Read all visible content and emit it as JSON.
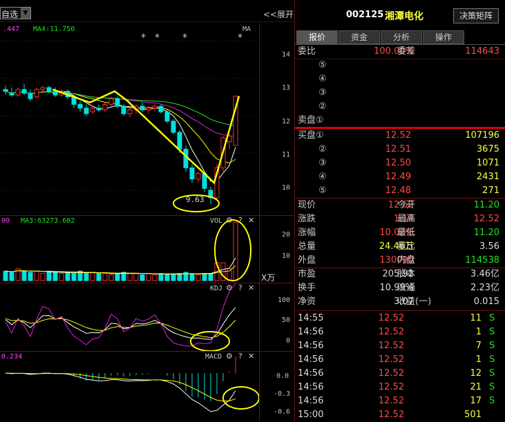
{
  "toolbar": {
    "watchlist_select": "自选",
    "expand_label": "<<展开"
  },
  "kline": {
    "ma_left": ".447",
    "ma4": "MA4:11.750",
    "ma_tag": "MA",
    "stars": [
      "*",
      "*",
      "*",
      "*"
    ],
    "price_axis": [
      "14",
      "13",
      "12",
      "11",
      "10"
    ],
    "low_label": "9.63"
  },
  "vol": {
    "left_value": "00",
    "ma3": "MA3:63273.602",
    "title": "VOL",
    "axis": [
      "20",
      "10"
    ],
    "unit": "X万"
  },
  "kdj": {
    "title": "KDJ",
    "axis": [
      "100",
      "50",
      "0"
    ]
  },
  "macd": {
    "left_value": "0.234",
    "title": "MACD",
    "axis": [
      "0.0",
      "-0.3",
      "-0.6"
    ]
  },
  "panel_icons": {
    "gear": "⚙",
    "help": "?",
    "close": "✕"
  },
  "stock": {
    "code": "002125",
    "name": "湘潭电化",
    "decision_button": "决策矩阵"
  },
  "tabs": [
    "报价",
    "资金",
    "分析",
    "操作"
  ],
  "order_summary": {
    "weibi_label": "委比",
    "weibi_value": "100.00%",
    "weicha_label": "委差",
    "weicha_value": "114643"
  },
  "sell_orders": [
    {
      "label": "⑤",
      "price": "",
      "vol": ""
    },
    {
      "label": "④",
      "price": "",
      "vol": ""
    },
    {
      "label": "③",
      "price": "",
      "vol": ""
    },
    {
      "label": "②",
      "price": "",
      "vol": ""
    },
    {
      "label": "卖盘①",
      "price": "",
      "vol": ""
    }
  ],
  "buy_orders": [
    {
      "label": "买盘①",
      "price": "12.52",
      "vol": "107196"
    },
    {
      "label": "②",
      "price": "12.51",
      "vol": "3675"
    },
    {
      "label": "③",
      "price": "12.50",
      "vol": "1071"
    },
    {
      "label": "④",
      "price": "12.49",
      "vol": "2431"
    },
    {
      "label": "⑤",
      "price": "12.48",
      "vol": "271"
    }
  ],
  "quote": [
    {
      "l1": "现价",
      "v1": "12.52",
      "c1": "red",
      "l2": "今开",
      "v2": "11.20",
      "c2": "grn"
    },
    {
      "l1": "涨跌",
      "v1": "1.14",
      "c1": "red",
      "l2": "最高",
      "v2": "12.52",
      "c2": "red"
    },
    {
      "l1": "涨幅",
      "v1": "10.02%",
      "c1": "red",
      "l2": "最低",
      "v2": "11.20",
      "c2": "grn"
    },
    {
      "l1": "总量",
      "v1": "24.46万",
      "c1": "yel",
      "l2": "量比",
      "v2": "3.56",
      "c2": "wht"
    },
    {
      "l1": "外盘",
      "v1": "130090",
      "c1": "red",
      "l2": "内盘",
      "v2": "114538",
      "c2": "grn"
    }
  ],
  "fundamentals": [
    {
      "l1": "市盈",
      "v1": "205.92",
      "l2": "股本",
      "v2": "3.46亿"
    },
    {
      "l1": "换手",
      "v1": "10.99%",
      "l2": "流通",
      "v2": "2.23亿"
    },
    {
      "l1": "净资",
      "v1": "3.07",
      "l2": "收益(一)",
      "v2": "0.015"
    }
  ],
  "ticks": [
    {
      "time": "14:55",
      "price": "12.52",
      "vol": "11",
      "side": "S"
    },
    {
      "time": "14:56",
      "price": "12.52",
      "vol": "1",
      "side": "S"
    },
    {
      "time": "14:56",
      "price": "12.52",
      "vol": "7",
      "side": "S"
    },
    {
      "time": "14:56",
      "price": "12.52",
      "vol": "1",
      "side": "S"
    },
    {
      "time": "14:56",
      "price": "12.52",
      "vol": "12",
      "side": "S"
    },
    {
      "time": "14:56",
      "price": "12.52",
      "vol": "21",
      "side": "S"
    },
    {
      "time": "14:56",
      "price": "12.52",
      "vol": "17",
      "side": "S"
    },
    {
      "time": "15:00",
      "price": "12.52",
      "vol": "501",
      "side": ""
    }
  ],
  "colors": {
    "up": "#ff3030",
    "down": "#00e0e0",
    "ma_white": "#ffffff",
    "ma_yellow": "#ffff00",
    "ma_purple": "#e020e0",
    "ma_green": "#20e020",
    "annotation": "#ffff00"
  },
  "chart_data": [
    {
      "type": "candlestick",
      "ohlc": [
        [
          12.7,
          12.8,
          12.55,
          12.65
        ],
        [
          12.6,
          12.75,
          12.5,
          12.55
        ],
        [
          12.55,
          12.75,
          12.5,
          12.7
        ],
        [
          12.7,
          12.85,
          12.55,
          12.6
        ],
        [
          12.6,
          12.7,
          12.4,
          12.45
        ],
        [
          12.5,
          12.75,
          12.45,
          12.7
        ],
        [
          12.7,
          12.8,
          12.6,
          12.75
        ],
        [
          12.75,
          12.8,
          12.6,
          12.65
        ],
        [
          12.65,
          12.75,
          12.5,
          12.55
        ],
        [
          12.55,
          12.7,
          12.5,
          12.65
        ],
        [
          12.65,
          12.7,
          12.45,
          12.5
        ],
        [
          12.5,
          12.55,
          12.2,
          12.3
        ],
        [
          12.3,
          12.4,
          12.1,
          12.2
        ],
        [
          12.2,
          12.3,
          12.0,
          12.05
        ],
        [
          12.1,
          12.25,
          12.05,
          12.2
        ],
        [
          12.2,
          12.3,
          12.1,
          12.15
        ],
        [
          12.15,
          12.35,
          12.1,
          12.3
        ],
        [
          12.3,
          12.5,
          12.25,
          12.45
        ],
        [
          12.45,
          12.5,
          12.2,
          12.25
        ],
        [
          12.25,
          12.3,
          12.0,
          12.05
        ],
        [
          12.05,
          12.2,
          11.95,
          12.15
        ],
        [
          12.15,
          12.3,
          12.05,
          12.25
        ],
        [
          12.25,
          12.35,
          12.1,
          12.15
        ],
        [
          12.15,
          12.25,
          12.05,
          12.2
        ],
        [
          12.2,
          12.3,
          12.1,
          12.25
        ],
        [
          12.25,
          12.3,
          12.05,
          12.1
        ],
        [
          12.1,
          12.15,
          11.8,
          11.85
        ],
        [
          11.85,
          11.9,
          11.5,
          11.55
        ],
        [
          11.55,
          11.6,
          11.0,
          11.1
        ],
        [
          11.1,
          11.2,
          10.5,
          10.6
        ],
        [
          10.6,
          10.7,
          10.2,
          10.3
        ],
        [
          10.3,
          10.5,
          10.2,
          10.45
        ],
        [
          10.45,
          10.5,
          9.95,
          10.05
        ],
        [
          10.0,
          10.1,
          9.63,
          9.8
        ],
        [
          9.8,
          10.7,
          9.7,
          10.6
        ],
        [
          10.6,
          11.45,
          10.5,
          11.4
        ],
        [
          11.3,
          11.5,
          11.1,
          11.45
        ],
        [
          11.2,
          12.52,
          11.2,
          12.52
        ]
      ],
      "ylim": [
        9.5,
        14.3
      ],
      "price_axis": [
        "14",
        "13",
        "12",
        "11",
        "10"
      ]
    },
    {
      "type": "bar",
      "name": "VOL",
      "values": [
        4,
        3.5,
        5,
        4,
        3.5,
        4,
        3,
        4,
        3.5,
        3,
        3.5,
        3,
        4,
        3,
        3.5,
        3,
        3,
        2.5,
        3,
        3.5,
        3,
        3,
        2.5,
        3,
        2.5,
        3,
        2.5,
        2.5,
        3,
        3.5,
        3,
        2.5,
        3,
        3,
        7.5,
        7.5,
        5,
        24.46
      ],
      "ylim": [
        0,
        26
      ],
      "axis": [
        "20",
        "10"
      ],
      "unit": "X万"
    },
    {
      "type": "line",
      "name": "KDJ",
      "ylim": [
        -15,
        118
      ],
      "axis": [
        "100",
        "50",
        "0"
      ]
    },
    {
      "type": "bar",
      "name": "MACD",
      "ylim": [
        -0.7,
        0.25
      ],
      "axis": [
        "0.0",
        "-0.3",
        "-0.6"
      ]
    }
  ]
}
